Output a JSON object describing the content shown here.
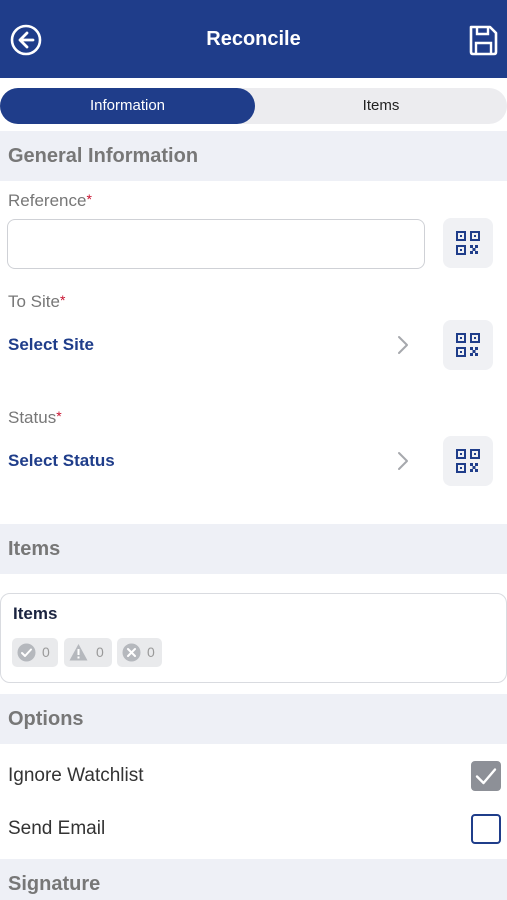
{
  "header": {
    "title": "Reconcile"
  },
  "tabs": [
    {
      "label": "Information",
      "active": true
    },
    {
      "label": "Items",
      "active": false
    }
  ],
  "sections": {
    "general": "General Information",
    "items": "Items",
    "options": "Options",
    "signature": "Signature"
  },
  "fields": {
    "reference": {
      "label": "Reference",
      "required_mark": "*",
      "value": ""
    },
    "to_site": {
      "label": "To Site",
      "required_mark": "*",
      "value": "Select Site"
    },
    "status": {
      "label": "Status",
      "required_mark": "*",
      "value": "Select Status"
    }
  },
  "items_card": {
    "title": "Items",
    "ok_count": "0",
    "warning_count": "0",
    "error_count": "0"
  },
  "options": [
    {
      "label": "Ignore Watchlist",
      "checked": true
    },
    {
      "label": "Send Email",
      "checked": false
    }
  ],
  "colors": {
    "primary": "#1f3d8a",
    "required": "#c8102e",
    "section_bg": "#eef0f6"
  }
}
